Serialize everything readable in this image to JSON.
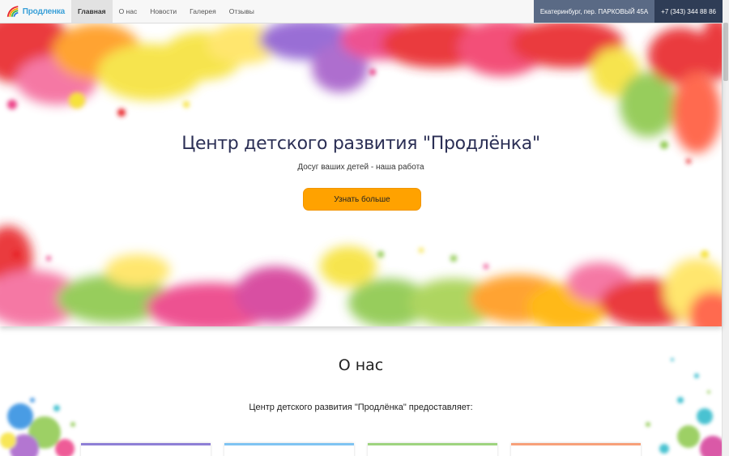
{
  "navbar": {
    "brand": "Продленка",
    "items": [
      {
        "label": "Главная",
        "active": true
      },
      {
        "label": "О нас",
        "active": false
      },
      {
        "label": "Новости",
        "active": false
      },
      {
        "label": "Галерея",
        "active": false
      },
      {
        "label": "Отзывы",
        "active": false
      }
    ],
    "address": "Екатеринбург, пер. ПАРКОВЫЙ 45А",
    "phone": "+7 (343) 344 88 86"
  },
  "hero": {
    "title": "Центр детского развития \"Продлёнка\"",
    "subtitle": "Досуг ваших детей - наша работа",
    "button": "Узнать больше"
  },
  "about": {
    "title": "О нас",
    "text": "Центр детского развития \"Продлёнка\" предоставляет:",
    "card_colors": [
      "#8e7fd6",
      "#7fc4f2",
      "#9ed47f",
      "#f7a07a"
    ]
  },
  "colors": {
    "accent": "#ffa200",
    "nav_address_bg": "#5a6a85",
    "nav_phone_bg": "#2f3d56"
  }
}
